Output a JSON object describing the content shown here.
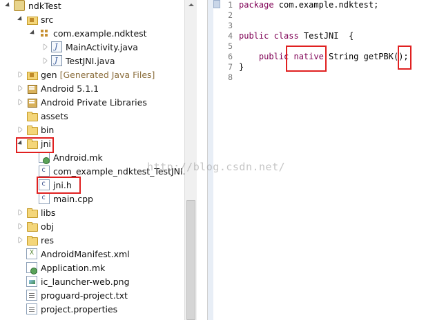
{
  "explorer": {
    "items": [
      {
        "label": "ndkTest",
        "indent": 0,
        "expand": "open",
        "icon": "project-icon",
        "muted": ""
      },
      {
        "label": "src",
        "indent": 1,
        "expand": "open",
        "icon": "source-folder-icon",
        "muted": ""
      },
      {
        "label": "com.example.ndktest",
        "indent": 2,
        "expand": "open",
        "icon": "package-icon",
        "muted": ""
      },
      {
        "label": "MainActivity.java",
        "indent": 3,
        "expand": "closed",
        "icon": "java-file-icon",
        "muted": ""
      },
      {
        "label": "TestJNI.java",
        "indent": 3,
        "expand": "closed",
        "icon": "java-file-icon",
        "muted": ""
      },
      {
        "label": "gen",
        "indent": 1,
        "expand": "closed",
        "icon": "source-folder-icon",
        "muted": "[Generated Java Files]"
      },
      {
        "label": "Android 5.1.1",
        "indent": 1,
        "expand": "closed",
        "icon": "library-icon",
        "muted": ""
      },
      {
        "label": "Android Private Libraries",
        "indent": 1,
        "expand": "closed",
        "icon": "library-icon",
        "muted": ""
      },
      {
        "label": "assets",
        "indent": 1,
        "expand": "none",
        "icon": "folder-icon",
        "muted": ""
      },
      {
        "label": "bin",
        "indent": 1,
        "expand": "closed",
        "icon": "folder-icon",
        "muted": ""
      },
      {
        "label": "jni",
        "indent": 1,
        "expand": "open",
        "icon": "folder-icon",
        "muted": ""
      },
      {
        "label": "Android.mk",
        "indent": 2,
        "expand": "none",
        "icon": "makefile-icon",
        "muted": ""
      },
      {
        "label": "com_example_ndktest_TestJNI.h",
        "indent": 2,
        "expand": "none",
        "icon": "c-header-icon",
        "muted": ""
      },
      {
        "label": "jni.h",
        "indent": 2,
        "expand": "none",
        "icon": "c-header-icon",
        "muted": ""
      },
      {
        "label": "main.cpp",
        "indent": 2,
        "expand": "none",
        "icon": "cpp-file-icon",
        "muted": ""
      },
      {
        "label": "libs",
        "indent": 1,
        "expand": "closed",
        "icon": "folder-icon",
        "muted": ""
      },
      {
        "label": "obj",
        "indent": 1,
        "expand": "closed",
        "icon": "folder-icon",
        "muted": ""
      },
      {
        "label": "res",
        "indent": 1,
        "expand": "closed",
        "icon": "folder-icon",
        "muted": ""
      },
      {
        "label": "AndroidManifest.xml",
        "indent": 1,
        "expand": "none",
        "icon": "xml-file-icon",
        "muted": ""
      },
      {
        "label": "Application.mk",
        "indent": 1,
        "expand": "none",
        "icon": "makefile-icon",
        "muted": ""
      },
      {
        "label": "ic_launcher-web.png",
        "indent": 1,
        "expand": "none",
        "icon": "image-file-icon",
        "muted": ""
      },
      {
        "label": "proguard-project.txt",
        "indent": 1,
        "expand": "none",
        "icon": "text-file-icon",
        "muted": ""
      },
      {
        "label": "project.properties",
        "indent": 1,
        "expand": "none",
        "icon": "text-file-icon",
        "muted": ""
      }
    ]
  },
  "editor": {
    "line_numbers": [
      "1",
      "2",
      "3",
      "4",
      "5",
      "6",
      "7",
      "8"
    ],
    "lines": [
      {
        "kw": "package",
        "text": " com.example.ndktest;"
      },
      {
        "kw": "",
        "text": ""
      },
      {
        "kw": "",
        "text": ""
      },
      {
        "kw": "public class",
        "text": " TestJNI  {"
      },
      {
        "kw": "",
        "text": ""
      },
      {
        "kw": "    public native",
        "text": " String getPBK();"
      },
      {
        "kw": "",
        "text": "}"
      },
      {
        "kw": "",
        "text": ""
      }
    ]
  },
  "watermark": "http://blog.csdn.net/",
  "colors": {
    "keyword": "#7f0055",
    "highlight": "#e02020",
    "watermark": "#969696"
  }
}
